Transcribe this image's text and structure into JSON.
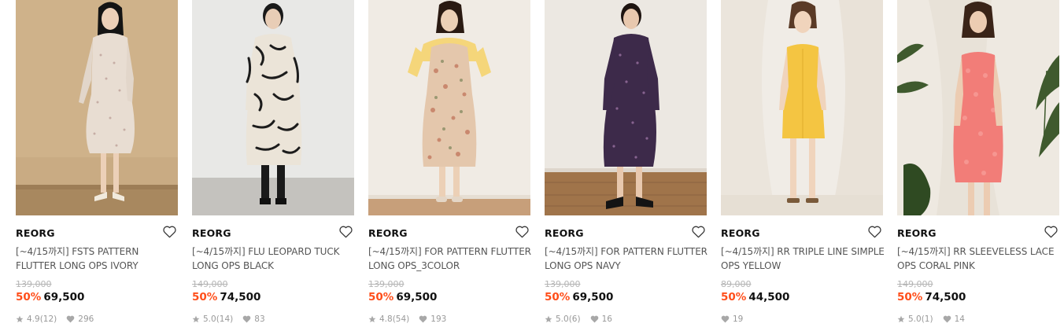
{
  "products": [
    {
      "brand": "REORG",
      "name": "[~4/15까지] FSTS PATTERN FLUTTER LONG OPS IVORY",
      "original_price": "139,000",
      "discount": "50%",
      "price": "69,500",
      "rating": "4.9",
      "review_count": "(12)",
      "likes": "296",
      "has_rating": true,
      "wishlist_icon": "heart-outline-icon"
    },
    {
      "brand": "REORG",
      "name": "[~4/15까지] FLU LEOPARD TUCK LONG OPS BLACK",
      "original_price": "149,000",
      "discount": "50%",
      "price": "74,500",
      "rating": "5.0",
      "review_count": "(14)",
      "likes": "83",
      "has_rating": true,
      "wishlist_icon": "heart-outline-icon"
    },
    {
      "brand": "REORG",
      "name": "[~4/15까지] FOR PATTERN FLUTTER LONG OPS_3COLOR",
      "original_price": "139,000",
      "discount": "50%",
      "price": "69,500",
      "rating": "4.8",
      "review_count": "(54)",
      "likes": "193",
      "has_rating": true,
      "wishlist_icon": "heart-outline-icon"
    },
    {
      "brand": "REORG",
      "name": "[~4/15까지] FOR PATTERN FLUTTER LONG OPS NAVY",
      "original_price": "139,000",
      "discount": "50%",
      "price": "69,500",
      "rating": "5.0",
      "review_count": "(6)",
      "likes": "16",
      "has_rating": true,
      "wishlist_icon": "heart-outline-icon"
    },
    {
      "brand": "REORG",
      "name": "[~4/15까지] RR TRIPLE LINE SIMPLE OPS YELLOW",
      "original_price": "89,000",
      "discount": "50%",
      "price": "44,500",
      "rating": "",
      "review_count": "",
      "likes": "19",
      "has_rating": false,
      "wishlist_icon": "heart-outline-icon"
    },
    {
      "brand": "REORG",
      "name": "[~4/15까지] RR SLEEVELESS LACE OPS CORAL PINK",
      "original_price": "149,000",
      "discount": "50%",
      "price": "74,500",
      "rating": "5.0",
      "review_count": "(1)",
      "likes": "14",
      "has_rating": true,
      "wishlist_icon": "heart-outline-icon"
    }
  ],
  "colors": {
    "discount": "#ff4e1a",
    "muted": "#999999",
    "strikethrough": "#b5b5b5",
    "brand": "#111111"
  },
  "icons": {
    "rating": "star-icon",
    "likes": "heart-icon"
  }
}
